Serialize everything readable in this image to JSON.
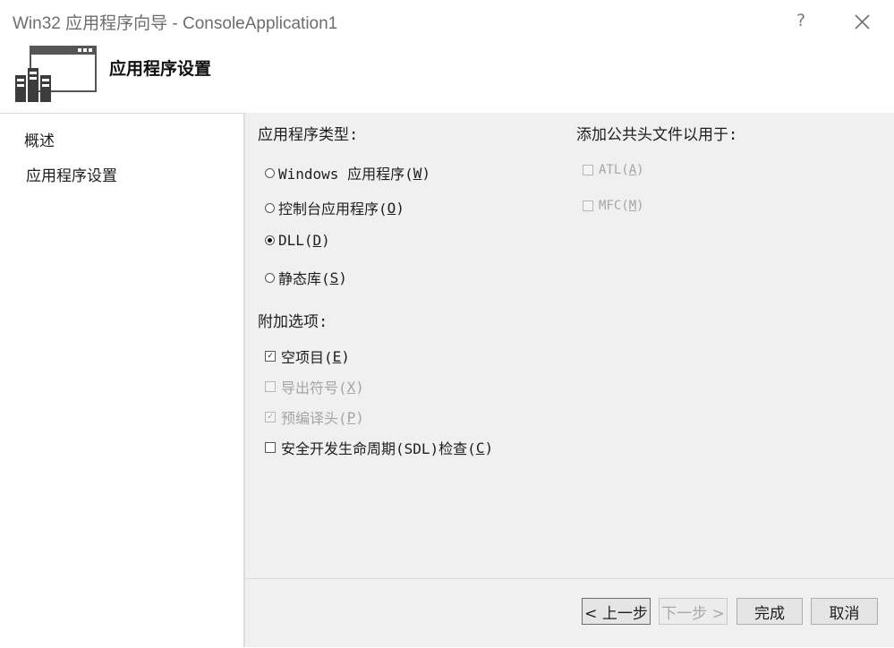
{
  "window": {
    "title": "Win32 应用程序向导 - ConsoleApplication1",
    "help_label": "?",
    "close_icon": "close-icon"
  },
  "header": {
    "title": "应用程序设置",
    "icon": "application-wizard-icon"
  },
  "nav": {
    "items": [
      {
        "label": "概述",
        "selected": false
      },
      {
        "label": "应用程序设置",
        "selected": true
      }
    ]
  },
  "app_type": {
    "label": "应用程序类型:",
    "options": [
      {
        "text": "Windows 应用程序(",
        "key": "W",
        "suffix": ")",
        "checked": false
      },
      {
        "text": "控制台应用程序(",
        "key": "O",
        "suffix": ")",
        "checked": false
      },
      {
        "text": "DLL(",
        "key": "D",
        "suffix": ")",
        "checked": true
      },
      {
        "text": "静态库(",
        "key": "S",
        "suffix": ")",
        "checked": false
      }
    ]
  },
  "additional": {
    "label": "附加选项:",
    "options": [
      {
        "text": "空项目(",
        "key": "E",
        "suffix": ")",
        "checked": true,
        "disabled": false
      },
      {
        "text": "导出符号(",
        "key": "X",
        "suffix": ")",
        "checked": false,
        "disabled": true
      },
      {
        "text": "预编译头(",
        "key": "P",
        "suffix": ")",
        "checked": true,
        "disabled": true
      },
      {
        "text": "安全开发生命周期(SDL)检查(",
        "key": "C",
        "suffix": ")",
        "checked": false,
        "disabled": false
      }
    ]
  },
  "common_headers": {
    "label": "添加公共头文件以用于:",
    "options": [
      {
        "text": "ATL(",
        "key": "A",
        "suffix": ")",
        "checked": false,
        "disabled": true
      },
      {
        "text": "MFC(",
        "key": "M",
        "suffix": ")",
        "checked": false,
        "disabled": true
      }
    ]
  },
  "buttons": {
    "prev": "< 上一步",
    "next": "下一步 >",
    "finish": "完成",
    "cancel": "取消"
  }
}
